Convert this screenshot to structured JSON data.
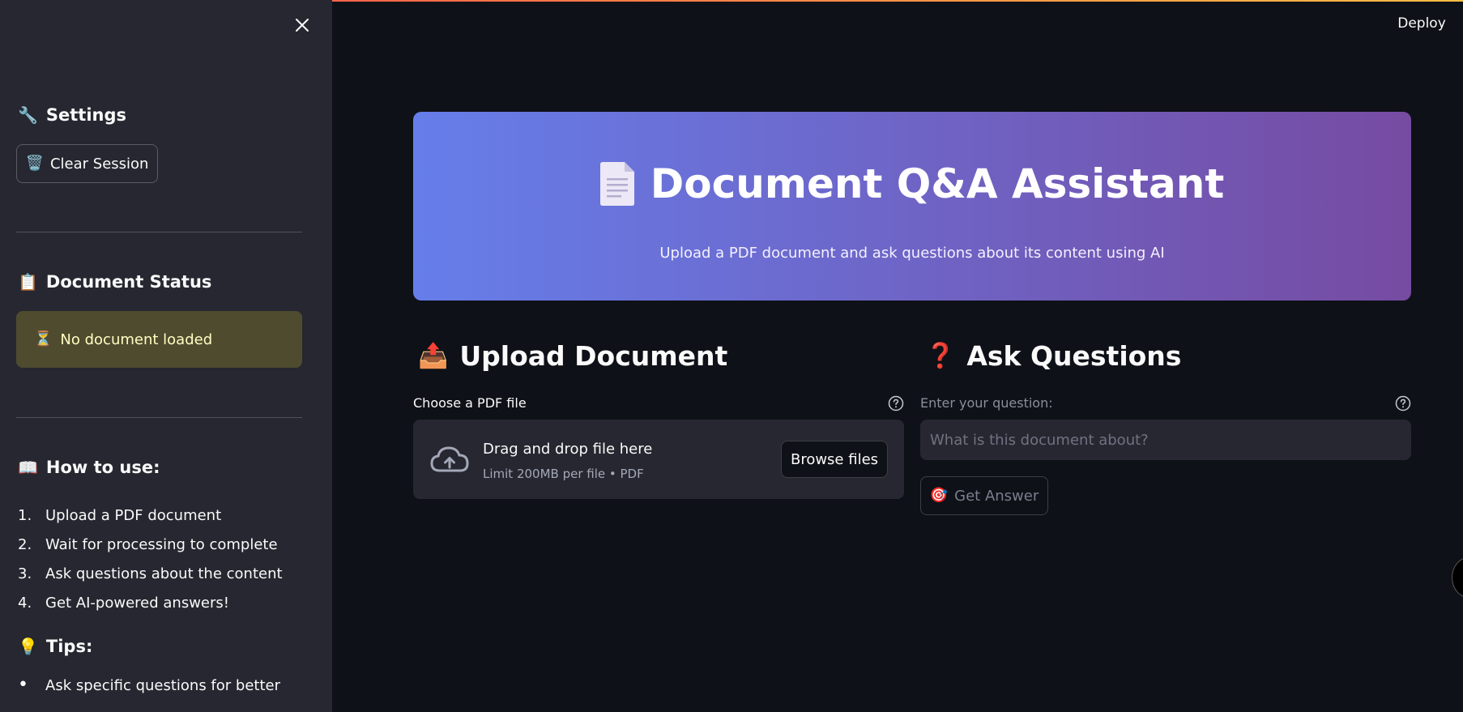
{
  "sidebar": {
    "close_label": "×",
    "settings_heading": "Settings",
    "settings_emoji": "🔧",
    "clear_session_label": "Clear Session",
    "clear_session_emoji": "🗑️",
    "status_heading": "Document Status",
    "status_emoji": "📋",
    "status_message": "No document loaded",
    "status_message_emoji": "⏳",
    "how_to_heading": "How to use:",
    "how_to_emoji": "📖",
    "steps": [
      {
        "num": "1.",
        "text": "Upload a PDF document"
      },
      {
        "num": "2.",
        "text": "Wait for processing to complete"
      },
      {
        "num": "3.",
        "text": "Ask questions about the content"
      },
      {
        "num": "4.",
        "text": "Get AI-powered answers!"
      }
    ],
    "tips_heading": "Tips:",
    "tips_emoji": "💡",
    "tips": [
      "Ask specific questions for better"
    ]
  },
  "header": {
    "deploy_label": "Deploy"
  },
  "hero": {
    "title": "Document Q&A Assistant",
    "subtitle": "Upload a PDF document and ask questions about its content using AI"
  },
  "upload": {
    "heading": "Upload Document",
    "heading_emoji": "📤",
    "label": "Choose a PDF file",
    "dropzone_title": "Drag and drop file here",
    "dropzone_sub": "Limit 200MB per file • PDF",
    "browse_label": "Browse files"
  },
  "ask": {
    "heading": "Ask Questions",
    "heading_emoji": "❓",
    "label": "Enter your question:",
    "placeholder": "What is this document about?",
    "button_label": "Get Answer",
    "button_emoji": "🎯"
  },
  "colors": {
    "background": "#0e1117",
    "sidebar": "#262730",
    "hero_start": "#667eea",
    "hero_end": "#764ba2",
    "status_bg": "#4f4b2f",
    "status_text": "#ffffc2"
  }
}
